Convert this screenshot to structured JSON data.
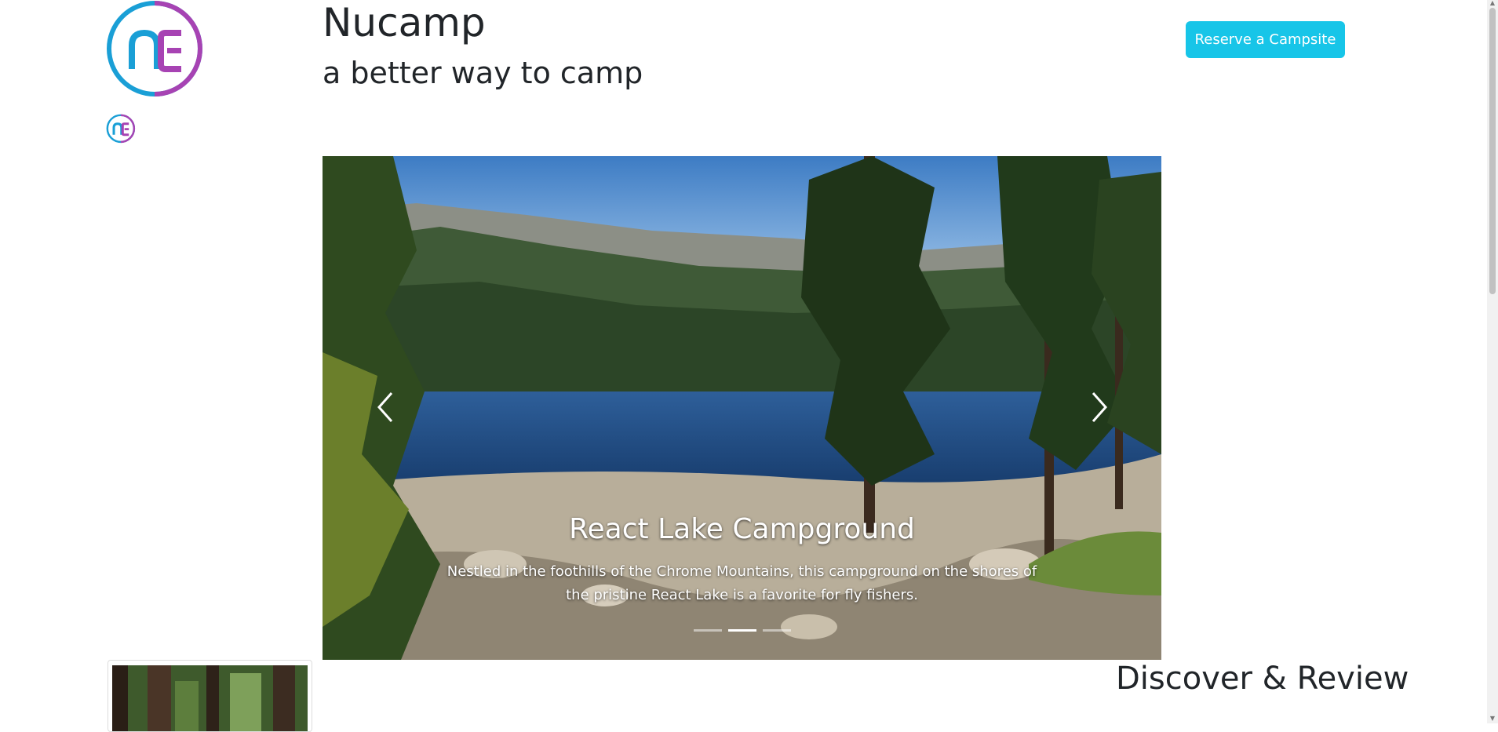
{
  "header": {
    "title": "Nucamp",
    "subtitle": "a better way to camp",
    "reserve_button": "Reserve a Campsite",
    "logo_text": "nc"
  },
  "carousel": {
    "slide_title": "React Lake Campground",
    "slide_text": "Nestled in the foothills of the Chrome Mountains, this campground on the shores of the pristine React Lake is a favorite for fly fishers.",
    "indicator_count": 3,
    "active_indicator": 2,
    "prev_icon": "chevron-left-icon",
    "next_icon": "chevron-right-icon"
  },
  "section": {
    "heading": "Discover & Review"
  },
  "colors": {
    "accent": "#17c5e8",
    "logo_blue": "#1a9fd6",
    "logo_purple": "#a743b3"
  }
}
